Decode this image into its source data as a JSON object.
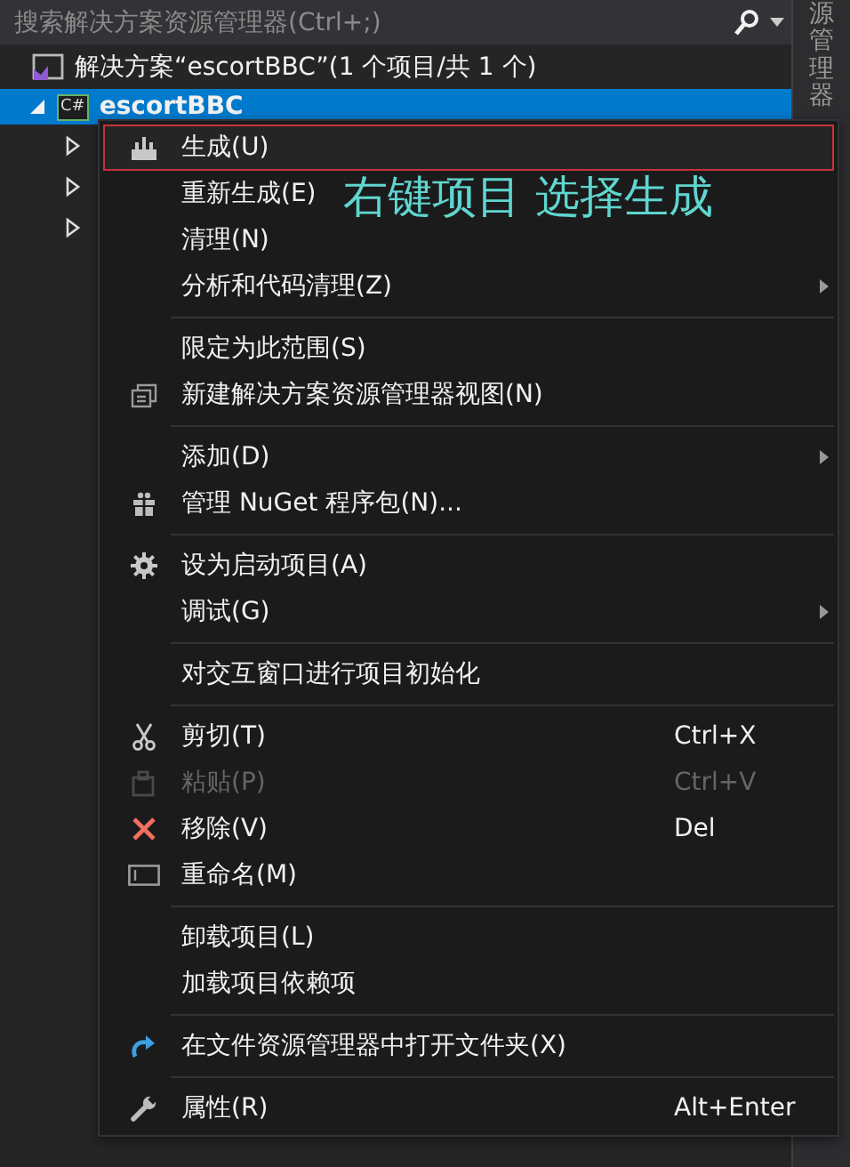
{
  "search": {
    "placeholder": "搜索解决方案资源管理器(Ctrl+;)"
  },
  "side_tab": {
    "label": "源管理器"
  },
  "tree": {
    "solution": {
      "label": "解决方案“escortBBC”(1 个项目/共 1 个)"
    },
    "project": {
      "badge": "C#",
      "label": "escortBBC",
      "selected": true,
      "expanded": true,
      "children": [
        {
          "expanded": false
        },
        {
          "expanded": false
        },
        {
          "expanded": false
        }
      ]
    }
  },
  "context_menu": {
    "sections": [
      {
        "items": [
          {
            "label": "生成(U)",
            "highlighted": true,
            "disabled": false,
            "submenu": false
          },
          {
            "label": "重新生成(E)",
            "highlighted": false,
            "disabled": false,
            "submenu": false
          },
          {
            "label": "清理(N)",
            "highlighted": false,
            "disabled": false,
            "submenu": false
          },
          {
            "label": "分析和代码清理(Z)",
            "highlighted": false,
            "disabled": false,
            "submenu": true
          }
        ]
      },
      {
        "items": [
          {
            "label": "限定为此范围(S)",
            "highlighted": false,
            "disabled": false,
            "submenu": false
          },
          {
            "label": "新建解决方案资源管理器视图(N)",
            "highlighted": false,
            "disabled": false,
            "submenu": false
          }
        ]
      },
      {
        "items": [
          {
            "label": "添加(D)",
            "highlighted": false,
            "disabled": false,
            "submenu": true
          },
          {
            "label": "管理 NuGet 程序包(N)...",
            "highlighted": false,
            "disabled": false,
            "submenu": false
          }
        ]
      },
      {
        "items": [
          {
            "label": "设为启动项目(A)",
            "highlighted": false,
            "disabled": false,
            "submenu": false
          },
          {
            "label": "调试(G)",
            "highlighted": false,
            "disabled": false,
            "submenu": true
          }
        ]
      },
      {
        "items": [
          {
            "label": "对交互窗口进行项目初始化",
            "highlighted": false,
            "disabled": false,
            "submenu": false
          }
        ]
      },
      {
        "items": [
          {
            "label": "剪切(T)",
            "shortcut": "Ctrl+X",
            "highlighted": false,
            "disabled": false,
            "submenu": false
          },
          {
            "label": "粘贴(P)",
            "shortcut": "Ctrl+V",
            "highlighted": false,
            "disabled": true,
            "submenu": false
          },
          {
            "label": "移除(V)",
            "shortcut": "Del",
            "highlighted": false,
            "disabled": false,
            "submenu": false
          },
          {
            "label": "重命名(M)",
            "highlighted": false,
            "disabled": false,
            "submenu": false
          }
        ]
      },
      {
        "items": [
          {
            "label": "卸载项目(L)",
            "highlighted": false,
            "disabled": false,
            "submenu": false
          },
          {
            "label": "加载项目依赖项",
            "highlighted": false,
            "disabled": false,
            "submenu": false
          }
        ]
      },
      {
        "items": [
          {
            "label": "在文件资源管理器中打开文件夹(X)",
            "highlighted": false,
            "disabled": false,
            "submenu": false
          }
        ]
      },
      {
        "items": [
          {
            "label": "属性(R)",
            "shortcut": "Alt+Enter",
            "highlighted": false,
            "disabled": false,
            "submenu": false
          }
        ]
      }
    ]
  },
  "annotation": {
    "text": "右键项目 选择生成"
  }
}
